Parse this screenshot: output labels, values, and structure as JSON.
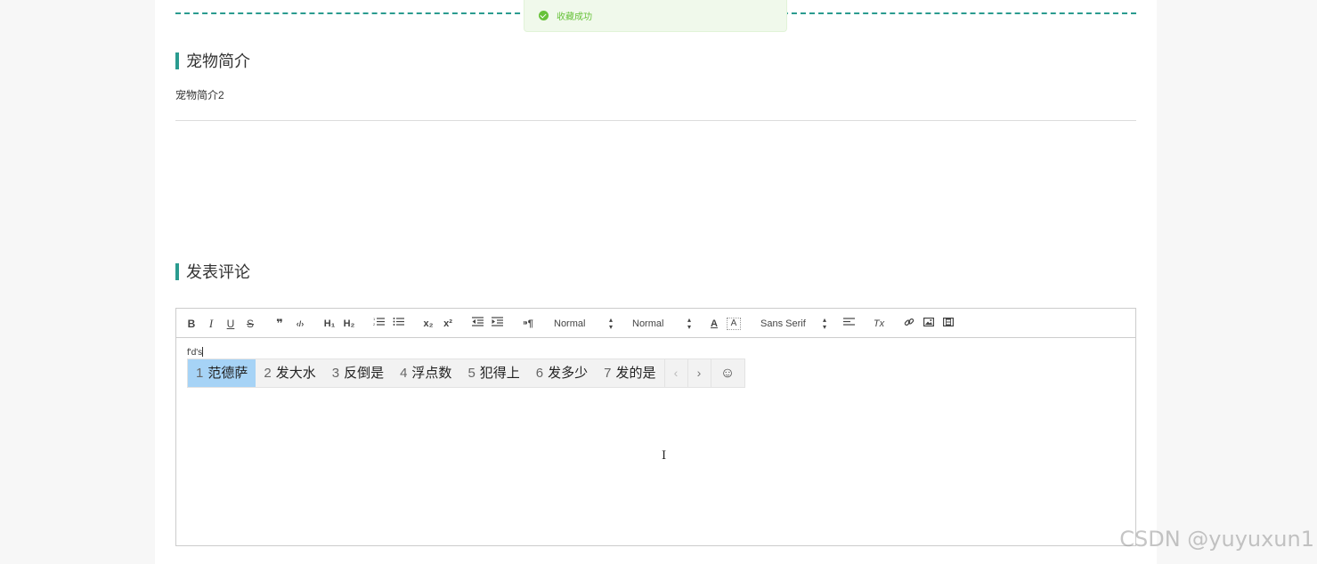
{
  "toast": {
    "message": "收藏成功"
  },
  "intro": {
    "title": "宠物简介",
    "text": "宠物简介2"
  },
  "comment": {
    "title": "发表评论"
  },
  "toolbar": {
    "bold": "B",
    "italic": "I",
    "underline": "U",
    "strike": "S",
    "blockquote": "❞",
    "code": "‹/›",
    "h1": "H₁",
    "h2": "H₂",
    "ordered_list": "⋮☰",
    "bullet_list": "☰",
    "subscript": "x₂",
    "superscript": "x²",
    "outdent": "⇤",
    "indent": "⇥",
    "direction": "⁍¶",
    "size_select": "Normal",
    "header_select": "Normal",
    "color": "A",
    "background": "A",
    "font_select": "Sans Serif",
    "align": "≡",
    "clean": "Tx",
    "link": "🔗",
    "image": "▣",
    "video": "▤"
  },
  "editor": {
    "typed_text": "f'd's"
  },
  "ime": {
    "candidates": [
      {
        "num": "1",
        "text": "范德萨"
      },
      {
        "num": "2",
        "text": "发大水"
      },
      {
        "num": "3",
        "text": "反倒是"
      },
      {
        "num": "4",
        "text": "浮点数"
      },
      {
        "num": "5",
        "text": "犯得上"
      },
      {
        "num": "6",
        "text": "发多少"
      },
      {
        "num": "7",
        "text": "发的是"
      }
    ],
    "prev": "‹",
    "next": "›",
    "emoji": "☺"
  },
  "cursor": {
    "glyph": "I"
  },
  "watermark": "CSDN @yuyuxun1",
  "colors": {
    "accent": "#2a9b8f",
    "toast_bg": "#f0f9eb",
    "toast_text": "#67c23a",
    "ime_selected": "#a6d3f6"
  }
}
